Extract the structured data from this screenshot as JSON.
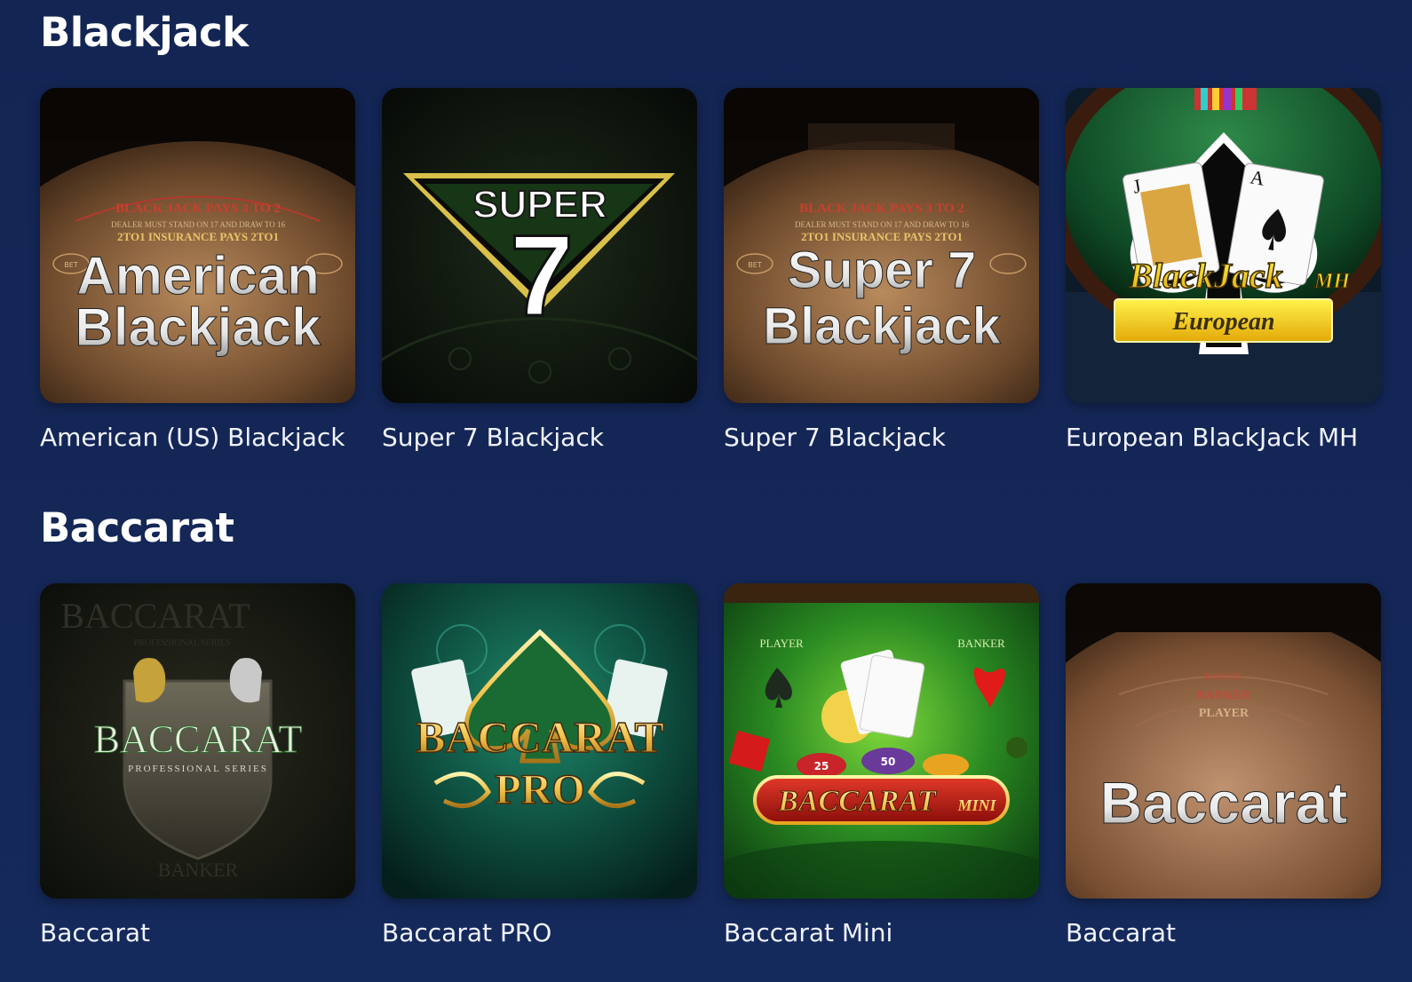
{
  "sections": [
    {
      "title": "Blackjack",
      "games": [
        {
          "name": "American (US) Blackjack",
          "art": {
            "line1": "American",
            "line2": "Blackjack",
            "table_text1": "BLACK JACK PAYS 3 TO 2",
            "table_text2": "DEALER MUST STAND ON 17 AND DRAW TO 16",
            "table_text3": "2TO1 INSURANCE PAYS 2TO1",
            "bet": "BET"
          }
        },
        {
          "name": "Super 7 Blackjack",
          "art": {
            "line1": "SUPER",
            "line2": "7"
          }
        },
        {
          "name": "Super 7 Blackjack",
          "art": {
            "line1": "Super 7",
            "line2": "Blackjack",
            "table_text1": "BLACK JACK PAYS 3 TO 2",
            "table_text2": "DEALER MUST STAND ON 17 AND DRAW TO 16",
            "table_text3": "2TO1 INSURANCE PAYS 2TO1",
            "bet": "BET"
          }
        },
        {
          "name": "European BlackJack MH",
          "art": {
            "line1": "BlackJack",
            "line1_suffix": "MH",
            "line2": "European",
            "card1": "J",
            "card2": "A"
          }
        }
      ]
    },
    {
      "title": "Baccarat",
      "games": [
        {
          "name": "Baccarat",
          "art": {
            "line1": "BACCARAT",
            "line2": "PROFESSIONAL SERIES",
            "bg_text1": "BACCARAT",
            "bg_text2": "PROFESSIONAL SERIES",
            "bg_text3": "BANKER"
          }
        },
        {
          "name": "Baccarat PRO",
          "art": {
            "line1": "BACCARAT",
            "line2": "PRO"
          }
        },
        {
          "name": "Baccarat Mini",
          "art": {
            "line1": "BACCARAT",
            "line1_suffix": "MINI",
            "player": "PLAYER",
            "banker": "BANKER",
            "chip1": "25",
            "chip2": "50"
          }
        },
        {
          "name": "Baccarat",
          "art": {
            "line1": "Baccarat",
            "table_text1": "PLAYER",
            "table_text2": "BANKER",
            "table_text3": "BANKERS"
          }
        }
      ]
    }
  ]
}
